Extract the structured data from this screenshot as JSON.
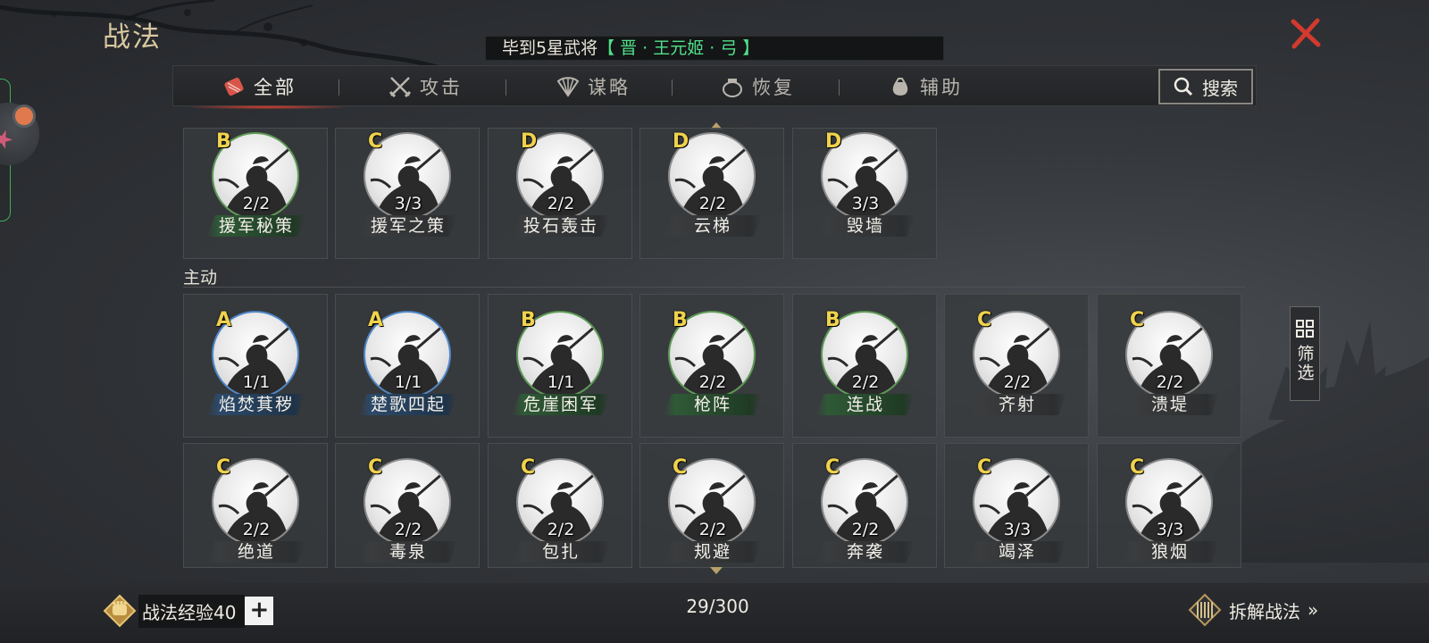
{
  "header": {
    "title": "战法",
    "news_prefix": "毕到5星武将",
    "news_highlight": "【 晋 · 王元姬 · 弓 】"
  },
  "tabs": [
    {
      "label": "全部",
      "icon": "scroll-icon",
      "active": true
    },
    {
      "label": "攻击",
      "icon": "crossed-swords-icon",
      "active": false
    },
    {
      "label": "谋略",
      "icon": "fan-icon",
      "active": false
    },
    {
      "label": "恢复",
      "icon": "medicine-pot-icon",
      "active": false
    },
    {
      "label": "辅助",
      "icon": "pouch-icon",
      "active": false
    }
  ],
  "search": {
    "label": "搜索"
  },
  "filter": {
    "label": "筛选"
  },
  "passive_row": [
    {
      "grade": "B",
      "level": "2/2",
      "name": "援军秘策",
      "quality": "B",
      "plate": "green"
    },
    {
      "grade": "C",
      "level": "3/3",
      "name": "援军之策",
      "quality": "C",
      "plate": "gray"
    },
    {
      "grade": "D",
      "level": "2/2",
      "name": "投石轰击",
      "quality": "D",
      "plate": "gray"
    },
    {
      "grade": "D",
      "level": "2/2",
      "name": "云梯",
      "quality": "D",
      "plate": "gray"
    },
    {
      "grade": "D",
      "level": "3/3",
      "name": "毁墙",
      "quality": "D",
      "plate": "gray"
    }
  ],
  "section_active_label": "主动",
  "active_row_1": [
    {
      "grade": "A",
      "level": "1/1",
      "name": "焰焚萁秽",
      "quality": "A",
      "plate": "blue"
    },
    {
      "grade": "A",
      "level": "1/1",
      "name": "楚歌四起",
      "quality": "A",
      "plate": "blue"
    },
    {
      "grade": "B",
      "level": "1/1",
      "name": "危崖困军",
      "quality": "B",
      "plate": "green"
    },
    {
      "grade": "B",
      "level": "2/2",
      "name": "枪阵",
      "quality": "B",
      "plate": "green"
    },
    {
      "grade": "B",
      "level": "2/2",
      "name": "连战",
      "quality": "B",
      "plate": "green"
    },
    {
      "grade": "C",
      "level": "2/2",
      "name": "齐射",
      "quality": "C",
      "plate": "gray"
    },
    {
      "grade": "C",
      "level": "2/2",
      "name": "溃堤",
      "quality": "C",
      "plate": "gray"
    }
  ],
  "active_row_2": [
    {
      "grade": "C",
      "level": "2/2",
      "name": "绝道",
      "quality": "C",
      "plate": "gray"
    },
    {
      "grade": "C",
      "level": "2/2",
      "name": "毒泉",
      "quality": "C",
      "plate": "gray"
    },
    {
      "grade": "C",
      "level": "2/2",
      "name": "包扎",
      "quality": "C",
      "plate": "gray"
    },
    {
      "grade": "C",
      "level": "2/2",
      "name": "规避",
      "quality": "C",
      "plate": "gray"
    },
    {
      "grade": "C",
      "level": "2/2",
      "name": "奔袭",
      "quality": "C",
      "plate": "gray"
    },
    {
      "grade": "C",
      "level": "3/3",
      "name": "竭泽",
      "quality": "C",
      "plate": "gray"
    },
    {
      "grade": "C",
      "level": "3/3",
      "name": "狼烟",
      "quality": "C",
      "plate": "gray"
    }
  ],
  "footer": {
    "exp_label": "战法经验40",
    "plus": "+",
    "count": "29/300",
    "dismantle_label": "拆解战法"
  },
  "colors": {
    "grade_text": "#f0d24c",
    "quality_A": "#4f86c8",
    "quality_B": "#5d9a55",
    "news_highlight": "#4fe08a",
    "close_x": "#d23a2e"
  }
}
